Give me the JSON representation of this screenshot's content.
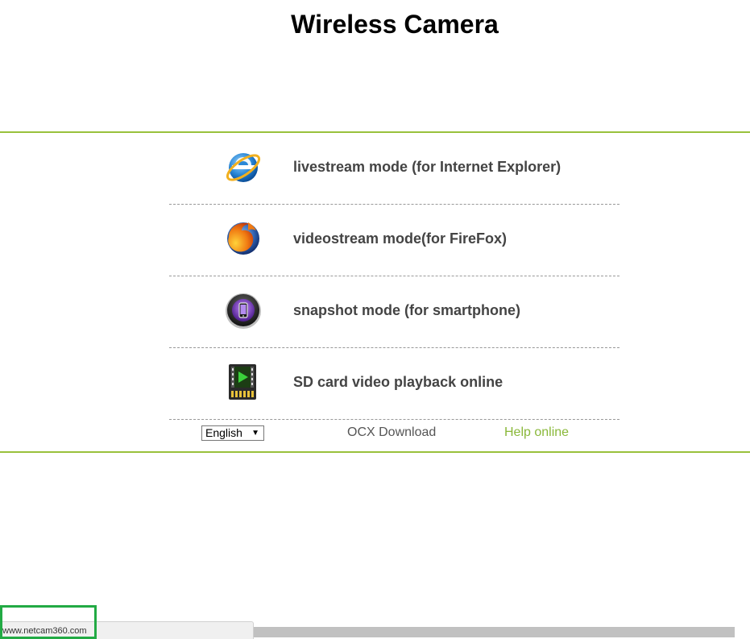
{
  "page": {
    "title": "Wireless Camera"
  },
  "menu": {
    "items": [
      {
        "label": "livestream mode (for Internet Explorer)",
        "icon": "internet-explorer-icon"
      },
      {
        "label": "videostream mode(for FireFox)",
        "icon": "firefox-icon"
      },
      {
        "label": "snapshot mode (for smartphone)",
        "icon": "smartphone-icon"
      },
      {
        "label": "SD card video playback online",
        "icon": "sd-card-video-icon"
      }
    ]
  },
  "footer": {
    "language_selected": "English",
    "ocx_label": "OCX Download",
    "help_label": "Help online"
  },
  "status": {
    "url": "www.netcam360.com"
  },
  "colors": {
    "accent_green": "#99c13c",
    "help_link": "#8ab83a",
    "label_text": "#444444"
  }
}
